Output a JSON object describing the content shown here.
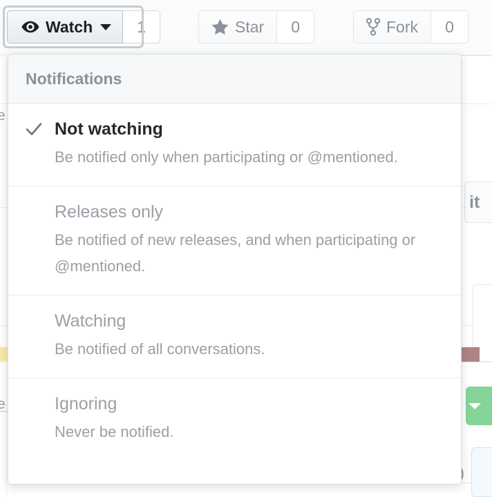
{
  "topbar": {
    "buttons": [
      {
        "id": "watch",
        "label": "Watch",
        "count": "1",
        "icon": "eye-icon",
        "has_caret": true,
        "focused": true
      },
      {
        "id": "star",
        "label": "Star",
        "count": "0",
        "icon": "star-icon",
        "has_caret": false,
        "focused": false
      },
      {
        "id": "fork",
        "label": "Fork",
        "count": "0",
        "icon": "fork-icon",
        "has_caret": false,
        "focused": false
      }
    ]
  },
  "dropdown": {
    "header": "Notifications",
    "items": [
      {
        "title": "Not watching",
        "description": "Be notified only when participating or @mentioned.",
        "selected": true
      },
      {
        "title": "Releases only",
        "description": "Be notified of new releases, and when participating or @mentioned.",
        "selected": false
      },
      {
        "title": "Watching",
        "description": "Be notified of all conversations.",
        "selected": false
      },
      {
        "title": "Ignoring",
        "description": "Never be notified.",
        "selected": false
      }
    ]
  },
  "background": {
    "left_sliver_top": "e",
    "left_sliver_bottom": "e",
    "right_button_label": "it",
    "right_blue_glyph": ")"
  },
  "colors": {
    "accent_green": "#85d49a",
    "accent_red": "#b08484",
    "accent_yellow": "#f6e9a8",
    "border": "#e1e4e8",
    "text_primary": "#24292e",
    "text_muted": "#9aa0a6",
    "header_bg": "#f6f8fa"
  }
}
